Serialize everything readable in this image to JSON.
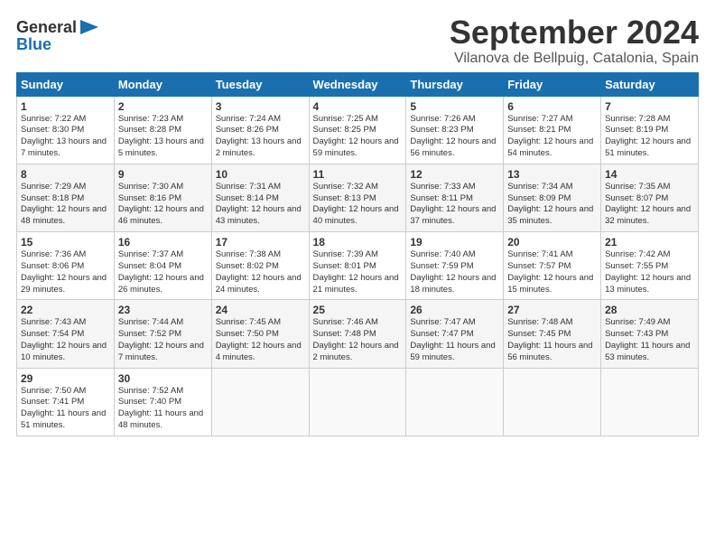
{
  "header": {
    "logo_general": "General",
    "logo_blue": "Blue",
    "month_title": "September 2024",
    "location": "Vilanova de Bellpuig, Catalonia, Spain"
  },
  "calendar": {
    "days_of_week": [
      "Sunday",
      "Monday",
      "Tuesday",
      "Wednesday",
      "Thursday",
      "Friday",
      "Saturday"
    ],
    "weeks": [
      [
        null,
        null,
        null,
        null,
        null,
        null,
        null
      ]
    ],
    "cells": [
      {
        "day": null
      },
      {
        "day": null
      },
      {
        "day": null
      },
      {
        "day": null
      },
      {
        "day": null
      },
      {
        "day": null
      },
      {
        "day": null
      },
      {
        "day": "1",
        "sunrise": "Sunrise: 7:22 AM",
        "sunset": "Sunset: 8:30 PM",
        "daylight": "Daylight: 13 hours and 7 minutes."
      },
      {
        "day": "2",
        "sunrise": "Sunrise: 7:23 AM",
        "sunset": "Sunset: 8:28 PM",
        "daylight": "Daylight: 13 hours and 5 minutes."
      },
      {
        "day": "3",
        "sunrise": "Sunrise: 7:24 AM",
        "sunset": "Sunset: 8:26 PM",
        "daylight": "Daylight: 13 hours and 2 minutes."
      },
      {
        "day": "4",
        "sunrise": "Sunrise: 7:25 AM",
        "sunset": "Sunset: 8:25 PM",
        "daylight": "Daylight: 12 hours and 59 minutes."
      },
      {
        "day": "5",
        "sunrise": "Sunrise: 7:26 AM",
        "sunset": "Sunset: 8:23 PM",
        "daylight": "Daylight: 12 hours and 56 minutes."
      },
      {
        "day": "6",
        "sunrise": "Sunrise: 7:27 AM",
        "sunset": "Sunset: 8:21 PM",
        "daylight": "Daylight: 12 hours and 54 minutes."
      },
      {
        "day": "7",
        "sunrise": "Sunrise: 7:28 AM",
        "sunset": "Sunset: 8:19 PM",
        "daylight": "Daylight: 12 hours and 51 minutes."
      },
      {
        "day": "8",
        "sunrise": "Sunrise: 7:29 AM",
        "sunset": "Sunset: 8:18 PM",
        "daylight": "Daylight: 12 hours and 48 minutes."
      },
      {
        "day": "9",
        "sunrise": "Sunrise: 7:30 AM",
        "sunset": "Sunset: 8:16 PM",
        "daylight": "Daylight: 12 hours and 46 minutes."
      },
      {
        "day": "10",
        "sunrise": "Sunrise: 7:31 AM",
        "sunset": "Sunset: 8:14 PM",
        "daylight": "Daylight: 12 hours and 43 minutes."
      },
      {
        "day": "11",
        "sunrise": "Sunrise: 7:32 AM",
        "sunset": "Sunset: 8:13 PM",
        "daylight": "Daylight: 12 hours and 40 minutes."
      },
      {
        "day": "12",
        "sunrise": "Sunrise: 7:33 AM",
        "sunset": "Sunset: 8:11 PM",
        "daylight": "Daylight: 12 hours and 37 minutes."
      },
      {
        "day": "13",
        "sunrise": "Sunrise: 7:34 AM",
        "sunset": "Sunset: 8:09 PM",
        "daylight": "Daylight: 12 hours and 35 minutes."
      },
      {
        "day": "14",
        "sunrise": "Sunrise: 7:35 AM",
        "sunset": "Sunset: 8:07 PM",
        "daylight": "Daylight: 12 hours and 32 minutes."
      },
      {
        "day": "15",
        "sunrise": "Sunrise: 7:36 AM",
        "sunset": "Sunset: 8:06 PM",
        "daylight": "Daylight: 12 hours and 29 minutes."
      },
      {
        "day": "16",
        "sunrise": "Sunrise: 7:37 AM",
        "sunset": "Sunset: 8:04 PM",
        "daylight": "Daylight: 12 hours and 26 minutes."
      },
      {
        "day": "17",
        "sunrise": "Sunrise: 7:38 AM",
        "sunset": "Sunset: 8:02 PM",
        "daylight": "Daylight: 12 hours and 24 minutes."
      },
      {
        "day": "18",
        "sunrise": "Sunrise: 7:39 AM",
        "sunset": "Sunset: 8:01 PM",
        "daylight": "Daylight: 12 hours and 21 minutes."
      },
      {
        "day": "19",
        "sunrise": "Sunrise: 7:40 AM",
        "sunset": "Sunset: 7:59 PM",
        "daylight": "Daylight: 12 hours and 18 minutes."
      },
      {
        "day": "20",
        "sunrise": "Sunrise: 7:41 AM",
        "sunset": "Sunset: 7:57 PM",
        "daylight": "Daylight: 12 hours and 15 minutes."
      },
      {
        "day": "21",
        "sunrise": "Sunrise: 7:42 AM",
        "sunset": "Sunset: 7:55 PM",
        "daylight": "Daylight: 12 hours and 13 minutes."
      },
      {
        "day": "22",
        "sunrise": "Sunrise: 7:43 AM",
        "sunset": "Sunset: 7:54 PM",
        "daylight": "Daylight: 12 hours and 10 minutes."
      },
      {
        "day": "23",
        "sunrise": "Sunrise: 7:44 AM",
        "sunset": "Sunset: 7:52 PM",
        "daylight": "Daylight: 12 hours and 7 minutes."
      },
      {
        "day": "24",
        "sunrise": "Sunrise: 7:45 AM",
        "sunset": "Sunset: 7:50 PM",
        "daylight": "Daylight: 12 hours and 4 minutes."
      },
      {
        "day": "25",
        "sunrise": "Sunrise: 7:46 AM",
        "sunset": "Sunset: 7:48 PM",
        "daylight": "Daylight: 12 hours and 2 minutes."
      },
      {
        "day": "26",
        "sunrise": "Sunrise: 7:47 AM",
        "sunset": "Sunset: 7:47 PM",
        "daylight": "Daylight: 11 hours and 59 minutes."
      },
      {
        "day": "27",
        "sunrise": "Sunrise: 7:48 AM",
        "sunset": "Sunset: 7:45 PM",
        "daylight": "Daylight: 11 hours and 56 minutes."
      },
      {
        "day": "28",
        "sunrise": "Sunrise: 7:49 AM",
        "sunset": "Sunset: 7:43 PM",
        "daylight": "Daylight: 11 hours and 53 minutes."
      },
      {
        "day": "29",
        "sunrise": "Sunrise: 7:50 AM",
        "sunset": "Sunset: 7:41 PM",
        "daylight": "Daylight: 11 hours and 51 minutes."
      },
      {
        "day": "30",
        "sunrise": "Sunrise: 7:52 AM",
        "sunset": "Sunset: 7:40 PM",
        "daylight": "Daylight: 11 hours and 48 minutes."
      },
      {
        "day": null
      },
      {
        "day": null
      },
      {
        "day": null
      },
      {
        "day": null
      },
      {
        "day": null
      }
    ]
  }
}
